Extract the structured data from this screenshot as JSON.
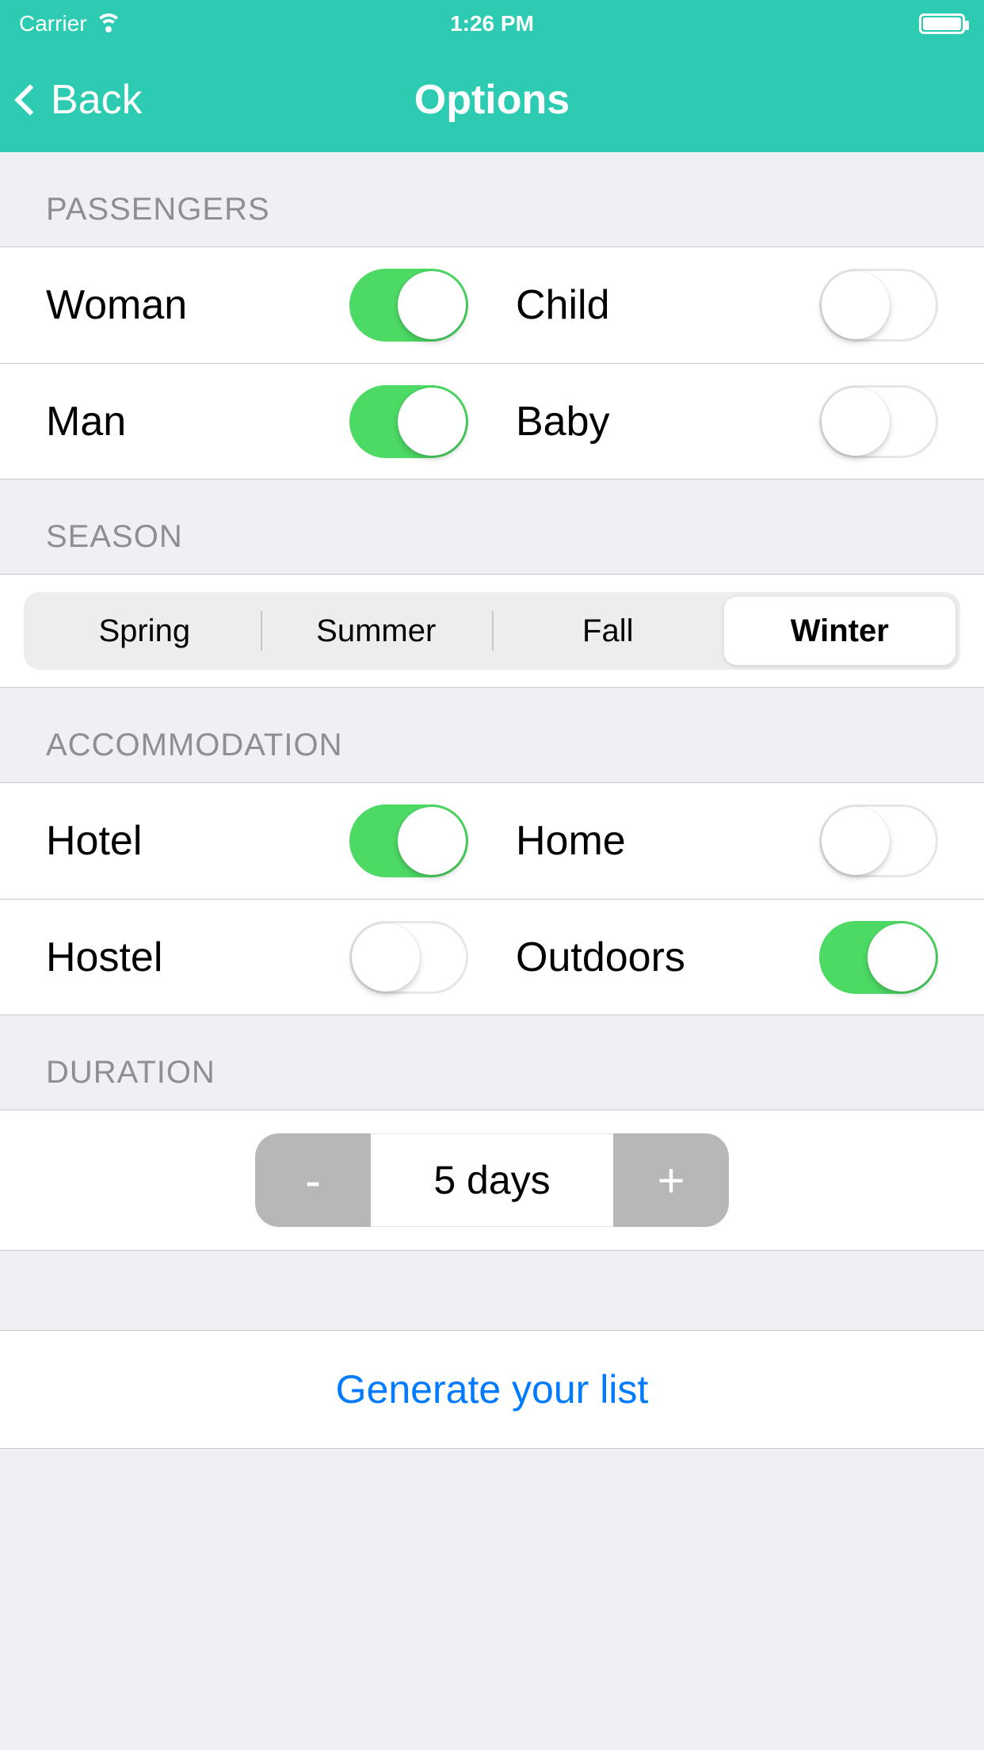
{
  "status": {
    "carrier": "Carrier",
    "time": "1:26 PM"
  },
  "nav": {
    "back": "Back",
    "title": "Options"
  },
  "sections": {
    "passengers": {
      "header": "PASSENGERS",
      "woman": {
        "label": "Woman",
        "on": true
      },
      "child": {
        "label": "Child",
        "on": false
      },
      "man": {
        "label": "Man",
        "on": true
      },
      "baby": {
        "label": "Baby",
        "on": false
      }
    },
    "season": {
      "header": "SEASON",
      "options": {
        "spring": "Spring",
        "summer": "Summer",
        "fall": "Fall",
        "winter": "Winter"
      },
      "selected": "winter"
    },
    "accommodation": {
      "header": "ACCOMMODATION",
      "hotel": {
        "label": "Hotel",
        "on": true
      },
      "home": {
        "label": "Home",
        "on": false
      },
      "hostel": {
        "label": "Hostel",
        "on": false
      },
      "outdoors": {
        "label": "Outdoors",
        "on": true
      }
    },
    "duration": {
      "header": "DURATION",
      "minus": "-",
      "plus": "+",
      "value": "5 days"
    }
  },
  "generate": "Generate your list",
  "colors": {
    "brand": "#2CCBB2",
    "link": "#007AFF",
    "switchOn": "#4CD964"
  }
}
